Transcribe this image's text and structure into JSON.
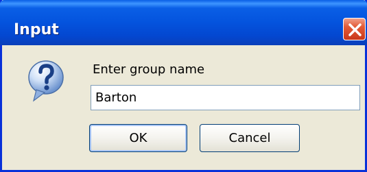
{
  "window": {
    "title": "Input"
  },
  "dialog": {
    "prompt": "Enter group name",
    "input_value": "Barton",
    "icon": "question-icon"
  },
  "buttons": {
    "ok_label": "OK",
    "cancel_label": "Cancel"
  },
  "colors": {
    "titlebar": "#0453dd",
    "dialog_background": "#ece9d8",
    "close_button": "#e35a35",
    "input_border": "#7f9db9"
  }
}
